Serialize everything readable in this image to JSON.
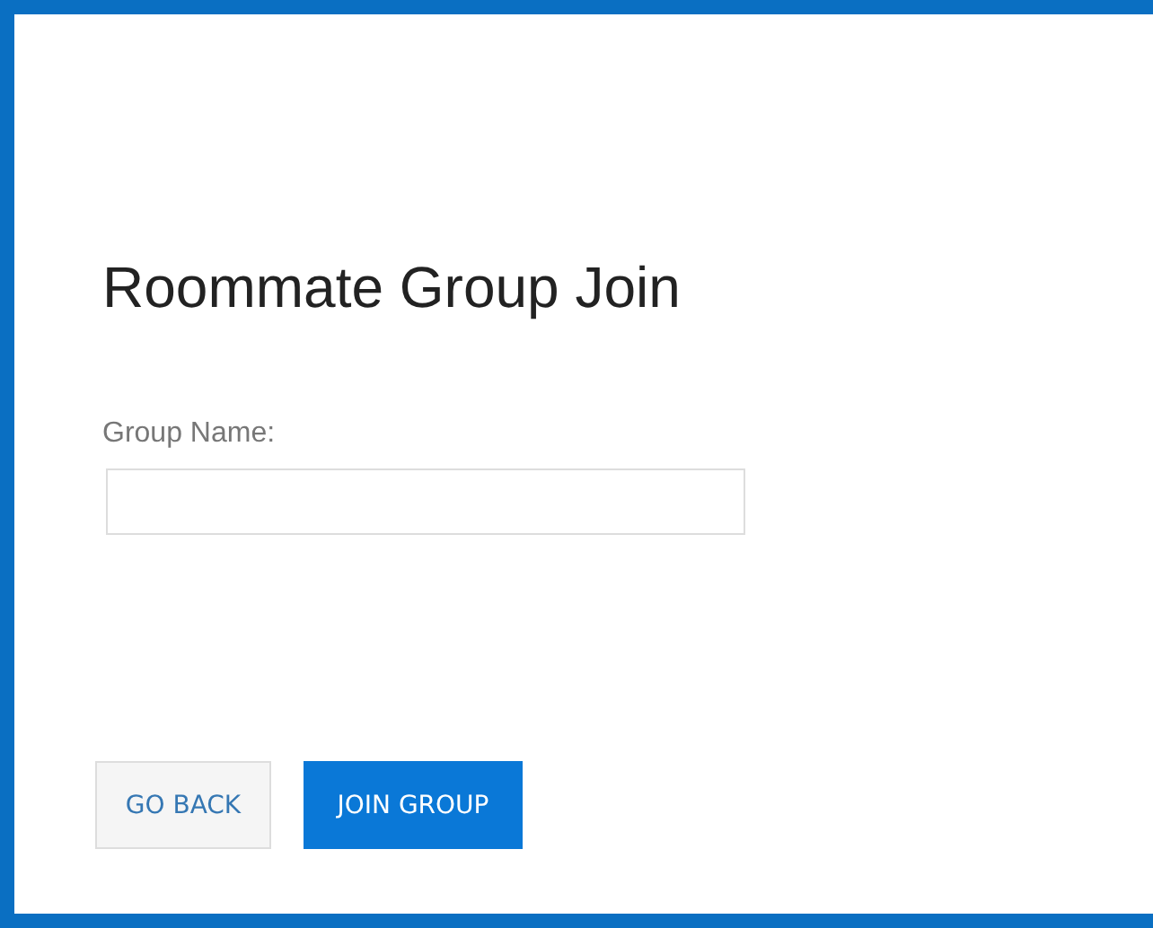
{
  "title": "Roommate Group Join",
  "field": {
    "label": "Group Name:"
  },
  "buttons": [
    {
      "label": "GO BACK",
      "kind": "secondary"
    },
    {
      "label": "JOIN GROUP",
      "kind": "primary"
    }
  ]
}
